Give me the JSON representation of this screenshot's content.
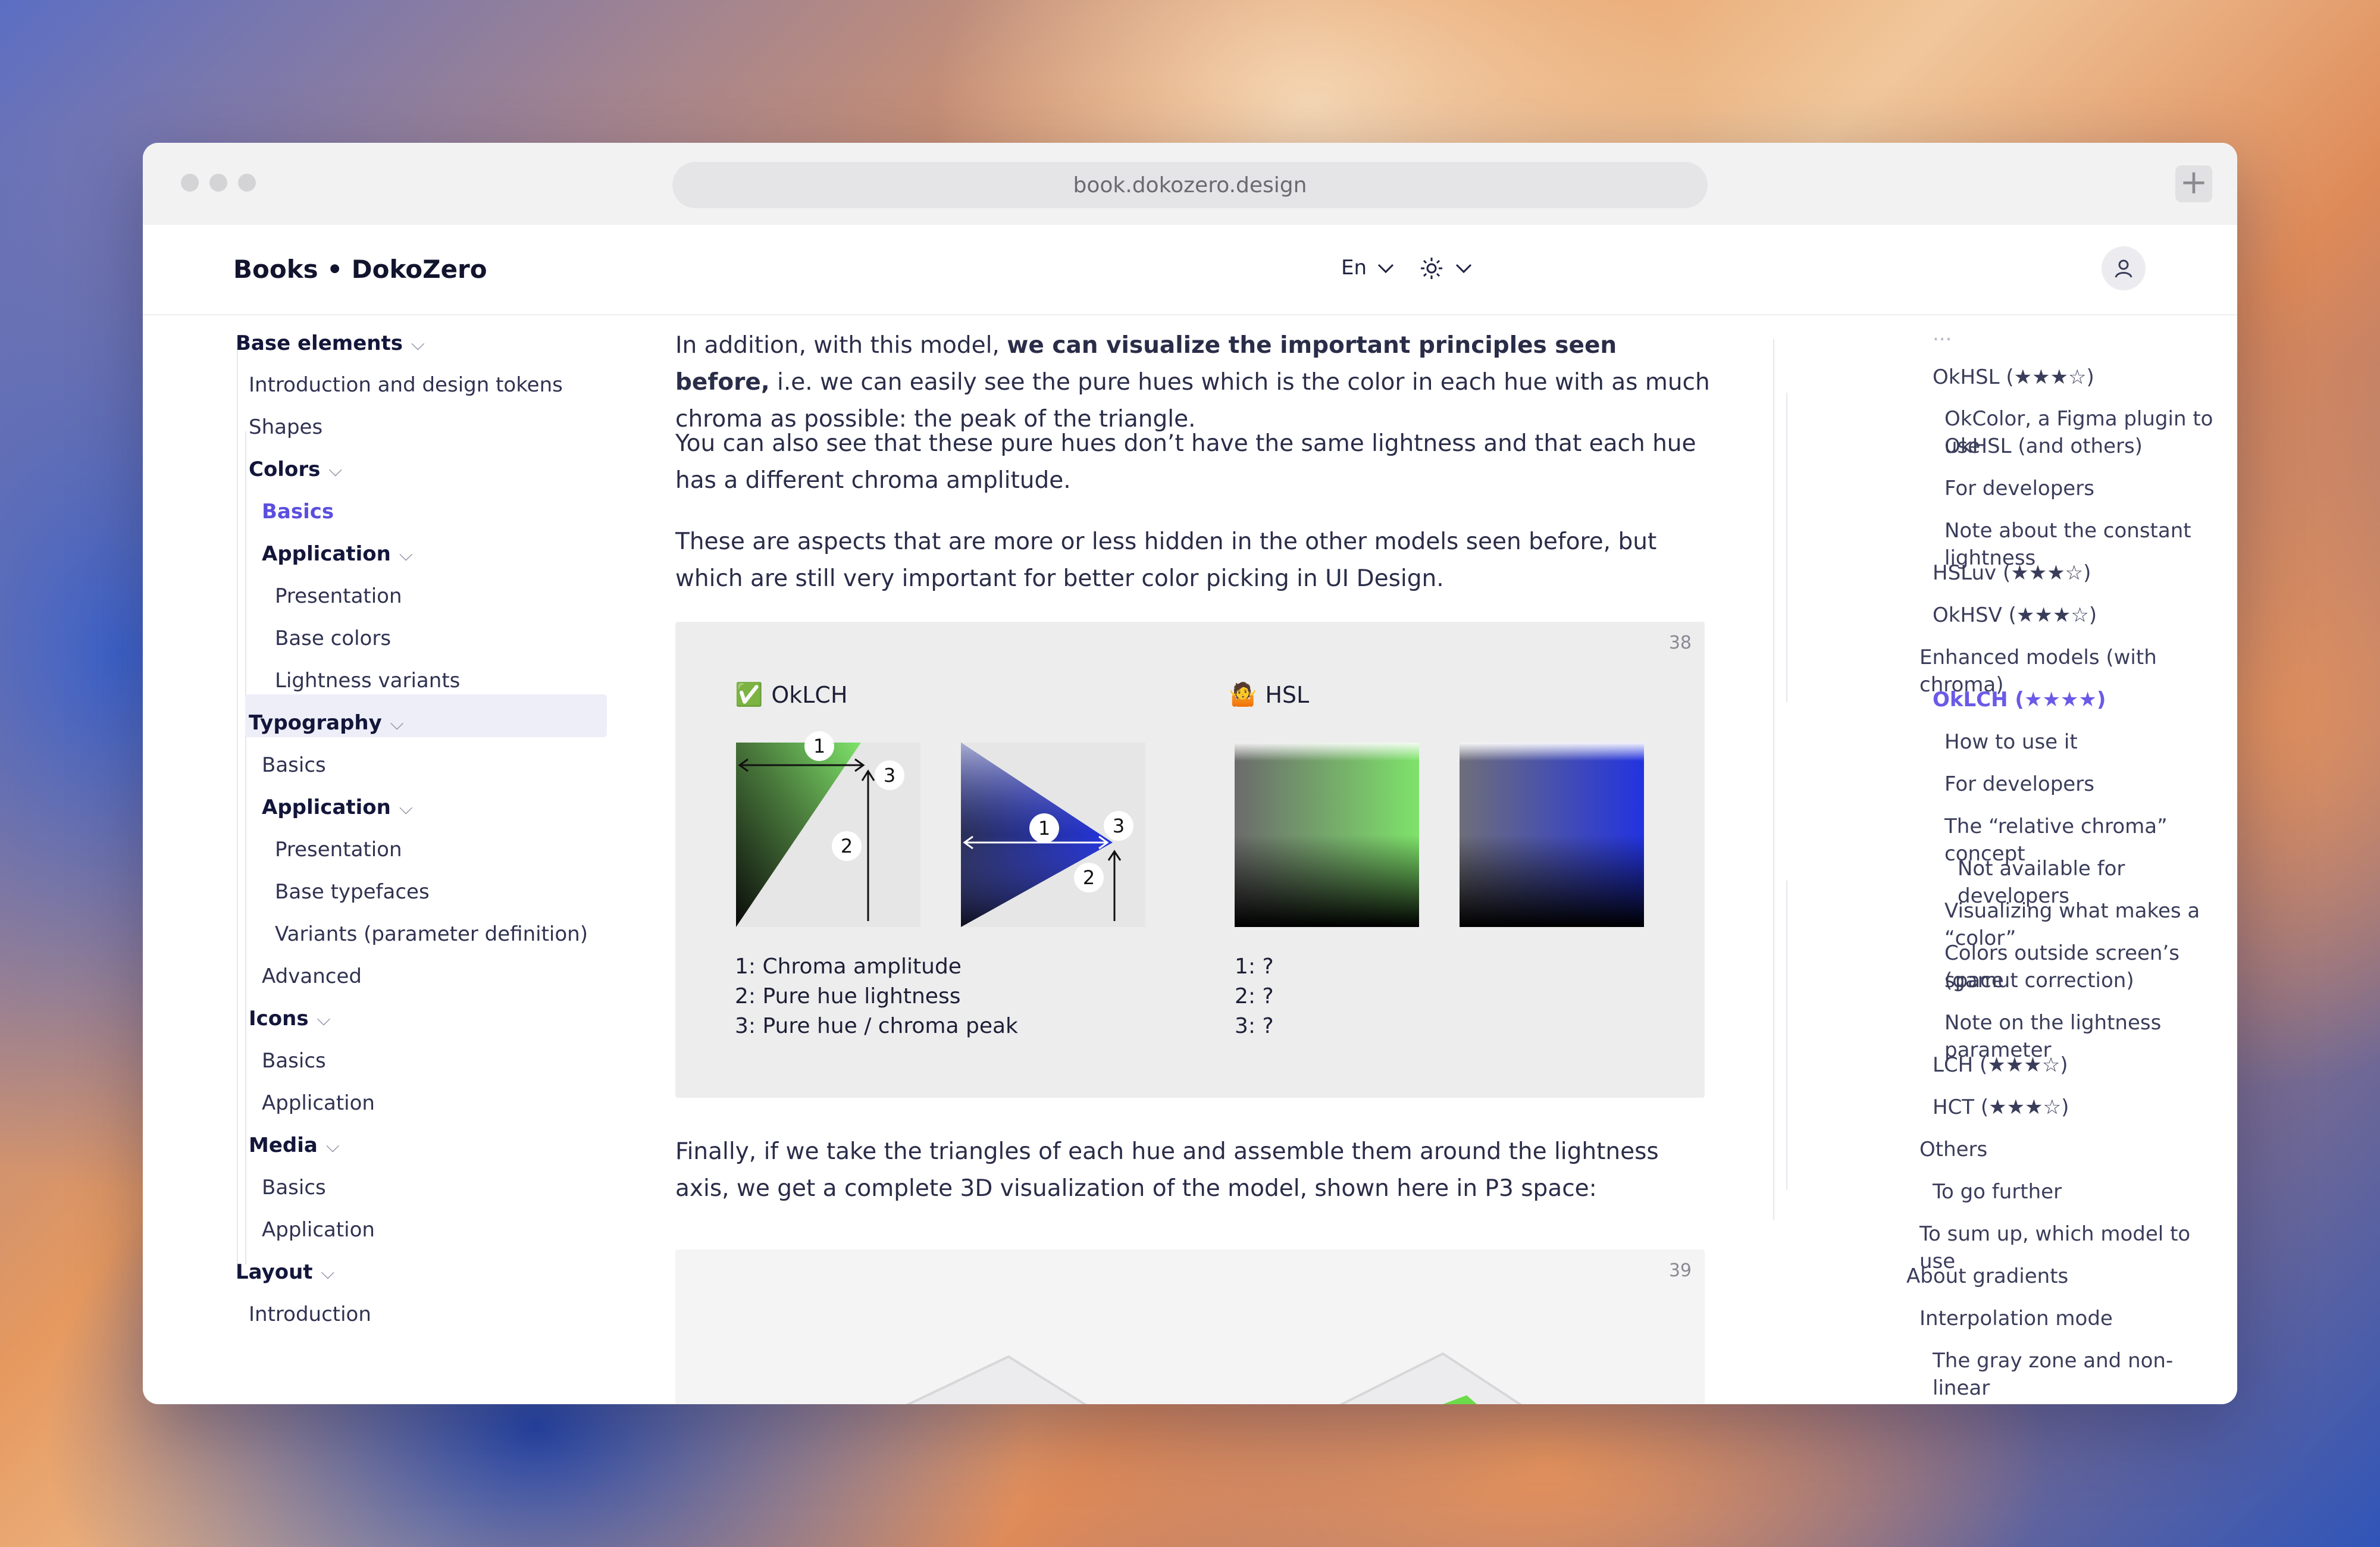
{
  "browser": {
    "url": "book.dokozero.design",
    "new_tab_label": "+"
  },
  "header": {
    "brand": "Books • DokoZero",
    "language": "En"
  },
  "sidebar": {
    "items": [
      {
        "label": "Base elements"
      },
      {
        "label": "Introduction and design tokens"
      },
      {
        "label": "Shapes"
      },
      {
        "label": "Colors"
      },
      {
        "label": "Basics"
      },
      {
        "label": "Application"
      },
      {
        "label": "Presentation"
      },
      {
        "label": "Base colors"
      },
      {
        "label": "Lightness variants"
      },
      {
        "label": "Typography"
      },
      {
        "label": "Basics"
      },
      {
        "label": "Application"
      },
      {
        "label": "Presentation"
      },
      {
        "label": "Base typefaces"
      },
      {
        "label": "Variants (parameter definition)"
      },
      {
        "label": "Advanced"
      },
      {
        "label": "Icons"
      },
      {
        "label": "Basics"
      },
      {
        "label": "Application"
      },
      {
        "label": "Media"
      },
      {
        "label": "Basics"
      },
      {
        "label": "Application"
      },
      {
        "label": "Layout"
      },
      {
        "label": "Introduction"
      }
    ]
  },
  "main": {
    "p1_a": "In addition, with this model, ",
    "p1_bold": "we can visualize the important principles seen before,",
    "p1_b": " i.e. we can easily see the pure hues which is the color in each hue with as much chroma as possible: the peak of the triangle.",
    "p2": "You can also see that these pure hues don’t have the same lightness and that each hue has a different chroma amplitude.",
    "p3": "These are aspects that are more or less hidden in the other models seen before, but which are still very important for better color picking in UI Design.",
    "p4": "Finally, if we take the triangles of each hue and assemble them around the lightness axis, we get a complete 3D visualization of the model, shown here in P3 space:",
    "figure38": {
      "number": "38",
      "oklch_icon": "✅",
      "oklch_label": "OkLCH",
      "hsl_icon": "🤷",
      "hsl_label": "HSL",
      "marker_1": "1",
      "marker_2": "2",
      "marker_3": "3",
      "oklch_legend": [
        "1: Chroma amplitude",
        "2: Pure hue lightness",
        "3: Pure hue / chroma peak"
      ],
      "hsl_legend": [
        "1: ?",
        "2: ?",
        "3: ?"
      ]
    },
    "figure39": {
      "number": "39"
    }
  },
  "toc": {
    "items": [
      {
        "label": "OkHSL (★★★☆)"
      },
      {
        "label": "OkColor, a Figma plugin to use"
      },
      {
        "label": "OkHSL (and others)"
      },
      {
        "label": "For developers"
      },
      {
        "label": "Note about the constant lightness"
      },
      {
        "label": "HSLuv (★★★☆)"
      },
      {
        "label": "OkHSV (★★★☆)"
      },
      {
        "label": "Enhanced models (with chroma)"
      },
      {
        "label": "OkLCH (★★★★)"
      },
      {
        "label": "How to use it"
      },
      {
        "label": "For developers"
      },
      {
        "label": "The “relative chroma” concept"
      },
      {
        "label": "Not available for developers"
      },
      {
        "label": "Visualizing what makes a “color”"
      },
      {
        "label": "Colors outside screen’s space"
      },
      {
        "label": "(gamut correction)"
      },
      {
        "label": "Note on the lightness parameter"
      },
      {
        "label": "LCH (★★★☆)"
      },
      {
        "label": "HCT (★★★☆)"
      },
      {
        "label": "Others"
      },
      {
        "label": "To go further"
      },
      {
        "label": "To sum up, which model to use"
      },
      {
        "label": "About gradients"
      },
      {
        "label": "Interpolation mode"
      },
      {
        "label": "The gray zone and non-linear"
      }
    ]
  },
  "colors": {
    "accent": "#5b4fe0",
    "green_peak": "#7ee36a",
    "blue_peak": "#2233e0"
  }
}
